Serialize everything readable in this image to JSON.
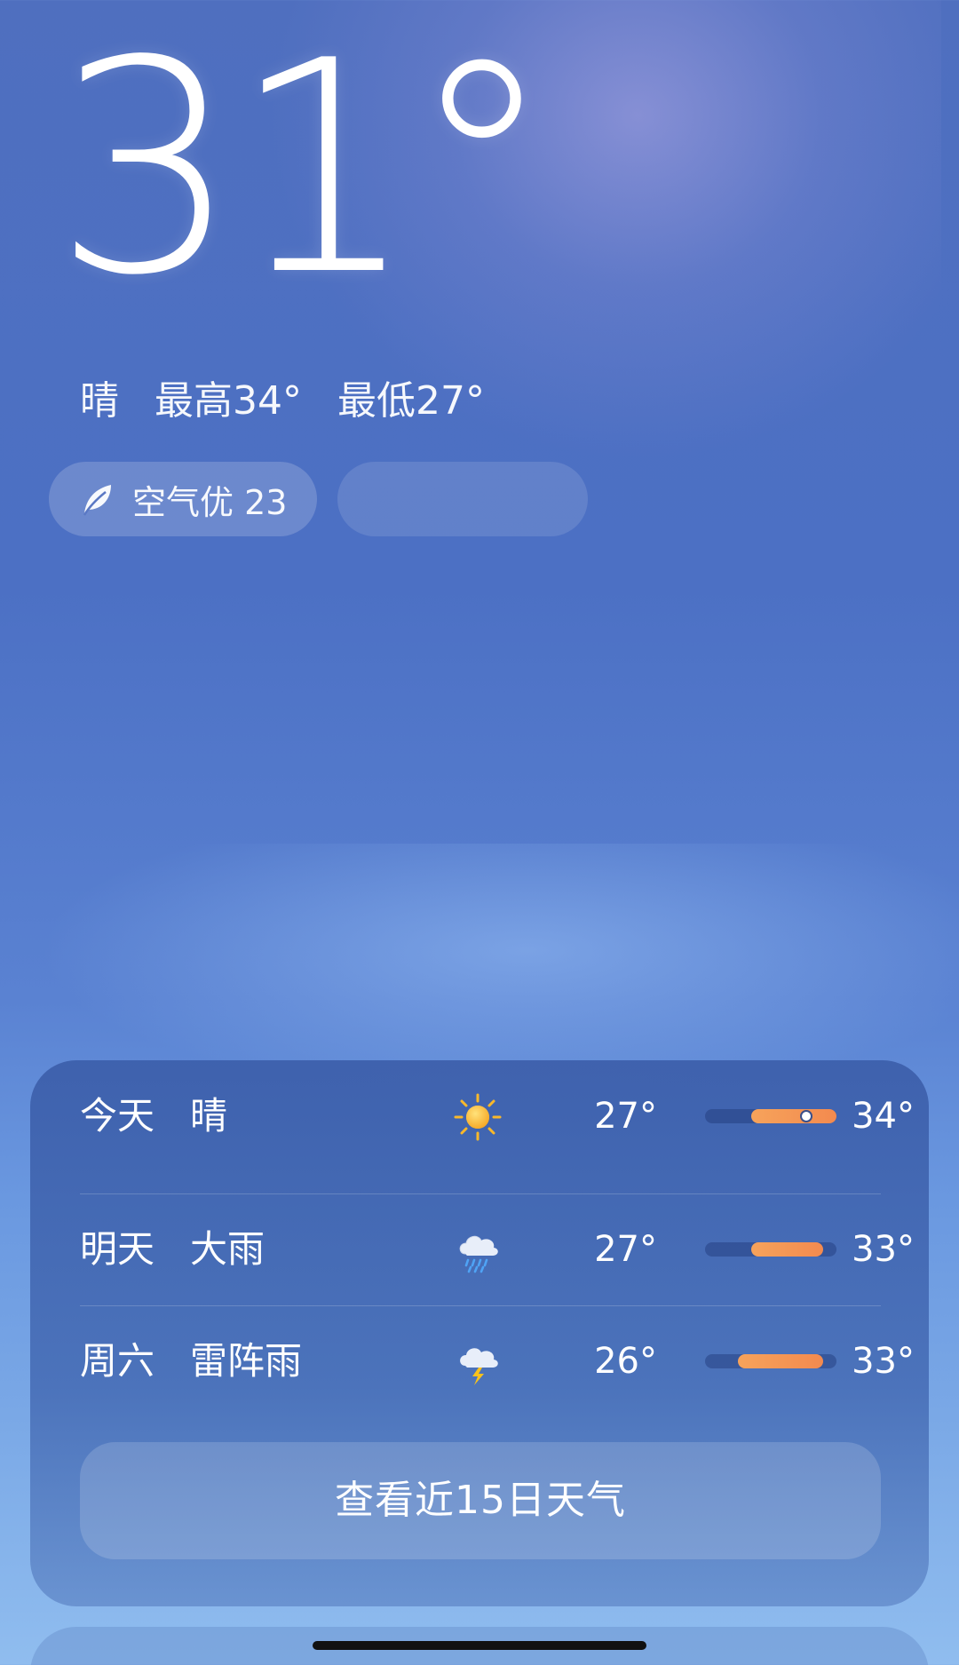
{
  "current": {
    "temperature": "31°",
    "condition": "晴",
    "high": "最高34°",
    "low": "最低27°"
  },
  "air_quality": {
    "label": "空气优 23"
  },
  "forecast": {
    "rows": [
      {
        "day": "今天",
        "condition": "晴",
        "icon": "sun-icon",
        "low": "27°",
        "high": "34°",
        "range_start": 0.35,
        "range_end": 1.0,
        "current_marker": 0.72
      },
      {
        "day": "明天",
        "condition": "大雨",
        "icon": "rain-cloud-icon",
        "low": "27°",
        "high": "33°",
        "range_start": 0.35,
        "range_end": 0.9
      },
      {
        "day": "周六",
        "condition": "雷阵雨",
        "icon": "thunderstorm-icon",
        "low": "26°",
        "high": "33°",
        "range_start": 0.25,
        "range_end": 0.9
      }
    ],
    "more_button": "查看近15日天气"
  },
  "colors": {
    "bar_fill": "#f38a4f",
    "sun": "#f9b82a"
  }
}
